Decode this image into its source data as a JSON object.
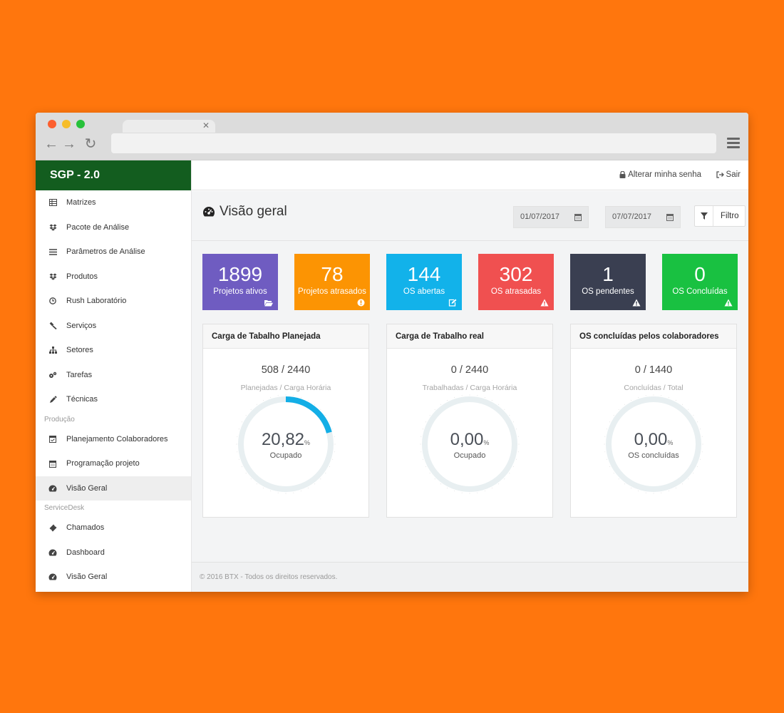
{
  "app": {
    "title": "SGP - 2.0"
  },
  "topbar": {
    "change_password": "Alterar minha senha",
    "logout": "Sair"
  },
  "sidebar": {
    "items": [
      {
        "label": "Matrizes",
        "icon": "table-icon"
      },
      {
        "label": "Pacote de Análise",
        "icon": "dropbox-icon"
      },
      {
        "label": "Parâmetros de Análise",
        "icon": "list-icon"
      },
      {
        "label": "Produtos",
        "icon": "dropbox-icon"
      },
      {
        "label": "Rush Laboratório",
        "icon": "clock-icon"
      },
      {
        "label": "Serviços",
        "icon": "gavel-icon"
      },
      {
        "label": "Setores",
        "icon": "sitemap-icon"
      },
      {
        "label": "Tarefas",
        "icon": "cogs-icon"
      },
      {
        "label": "Técnicas",
        "icon": "eyedropper-icon"
      }
    ],
    "section_producao": "Produção",
    "producao_items": [
      {
        "label": "Planejamento Colaboradores",
        "icon": "calendar-check-icon"
      },
      {
        "label": "Programação projeto",
        "icon": "calendar-icon"
      },
      {
        "label": "Visão Geral",
        "icon": "dashboard-icon"
      }
    ],
    "section_servicedesk": "ServiceDesk",
    "servicedesk_items": [
      {
        "label": "Chamados",
        "icon": "ticket-icon"
      },
      {
        "label": "Dashboard",
        "icon": "dashboard-icon"
      },
      {
        "label": "Visão Geral",
        "icon": "dashboard-icon"
      }
    ]
  },
  "page": {
    "title": "Visão geral",
    "date_start": "01/07/2017",
    "date_end": "07/07/2017",
    "filter_label": "Filtro"
  },
  "stats": [
    {
      "value": "1899",
      "label": "Projetos ativos",
      "color": "#6f5cc1",
      "icon": "folder-open-icon"
    },
    {
      "value": "78",
      "label": "Projetos atrasados",
      "color": "#fc9403",
      "icon": "exclamation-circle-icon"
    },
    {
      "value": "144",
      "label": "OS abertas",
      "color": "#12b2ea",
      "icon": "edit-icon"
    },
    {
      "value": "302",
      "label": "OS atrasadas",
      "color": "#f05050",
      "icon": "warning-icon"
    },
    {
      "value": "1",
      "label": "OS pendentes",
      "color": "#3a3f51",
      "icon": "warning-icon"
    },
    {
      "value": "0",
      "label": "OS Concluídas",
      "color": "#19c141",
      "icon": "warning-icon"
    }
  ],
  "panels": [
    {
      "title": "Carga de Tabalho Planejada",
      "ratio": "508 / 2440",
      "sub": "Planejadas / Carga Horária",
      "value": "20,82",
      "unit": "%",
      "label": "Ocupado",
      "percent": 20.82
    },
    {
      "title": "Carga de Trabalho real",
      "ratio": "0 / 2440",
      "sub": "Trabalhadas / Carga Horária",
      "value": "0,00",
      "unit": "%",
      "label": "Ocupado",
      "percent": 0
    },
    {
      "title": "OS concluídas pelos colaboradores",
      "ratio": "0 / 1440",
      "sub": "Concluídas / Total",
      "value": "0,00",
      "unit": "%",
      "label": "OS concluídas",
      "percent": 0
    }
  ],
  "colors": {
    "gauge_track": "#e8eff1",
    "gauge_fill": "#13aee6",
    "brand": "#135d1f"
  },
  "footer": {
    "text": "© 2016 BTX - Todos os direitos reservados."
  }
}
